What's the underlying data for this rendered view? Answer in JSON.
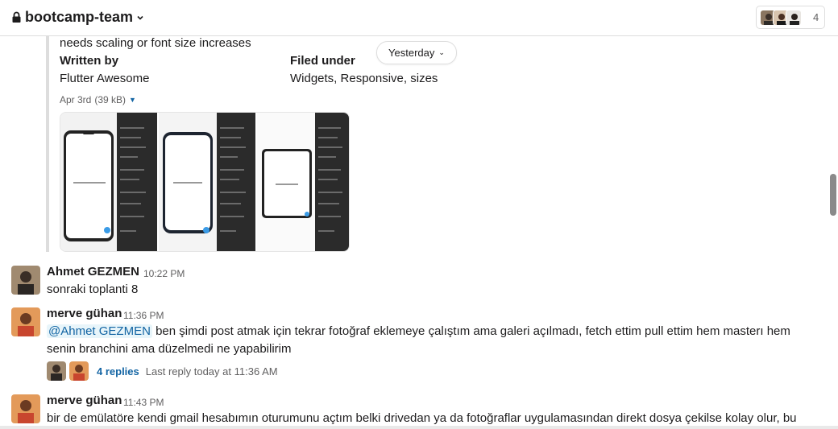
{
  "header": {
    "channel_name": "bootcamp-team",
    "member_count": "4"
  },
  "attachment": {
    "description_tail": "needs scaling or font size increases",
    "written_by_label": "Written by",
    "written_by_value": "Flutter Awesome",
    "filed_under_label": "Filed under",
    "filed_under_value": "Widgets, Responsive, sizes",
    "file_date": "Apr 3rd",
    "file_size": "(39 kB)"
  },
  "date_divider": {
    "label": "Yesterday"
  },
  "messages": [
    {
      "sender": "Ahmet GEZMEN",
      "time": "10:22 PM",
      "text": "sonraki toplanti 8"
    },
    {
      "sender": "merve gühan",
      "time": "11:36 PM",
      "mention": "@Ahmet GEZMEN",
      "text": " ben şimdi post atmak için tekrar fotoğraf eklemeye çalıştım ama galeri açılmadı, fetch ettim pull ettim hem masterı hem senin branchini ama düzelmedi ne yapabilirim",
      "thread": {
        "replies": "4 replies",
        "last_reply": "Last reply today at 11:36 AM"
      }
    },
    {
      "sender": "merve gühan",
      "time": "11:43 PM",
      "text": "bir de emülatöre kendi gmail hesabımın oturumunu açtım belki drivedan ya da fotoğraflar uygulamasından direkt dosya çekilse kolay olur, bu"
    }
  ],
  "colors": {
    "link": "#1264a3",
    "text": "#1d1c1d",
    "muted": "#616061",
    "border": "#dddddd"
  },
  "icons": [
    "lock-icon",
    "chevron-down-icon",
    "caret-down-icon"
  ]
}
